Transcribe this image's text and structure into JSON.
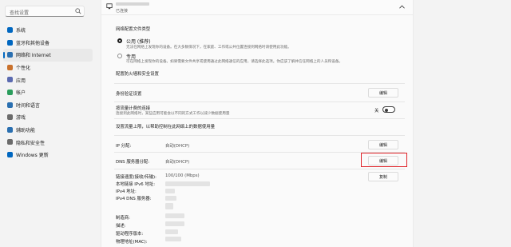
{
  "search": {
    "placeholder": "查找设置"
  },
  "sidebar": {
    "items": [
      {
        "label": "系统",
        "icon": "monitor-icon",
        "color": "#0067c0"
      },
      {
        "label": "蓝牙和其他设备",
        "icon": "bluetooth-icon",
        "color": "#0067c0"
      },
      {
        "label": "网络和 Internet",
        "icon": "network-icon",
        "color": "#2a6fb0",
        "active": true
      },
      {
        "label": "个性化",
        "icon": "brush-icon",
        "color": "#c9712c"
      },
      {
        "label": "应用",
        "icon": "apps-icon",
        "color": "#5b6ab0"
      },
      {
        "label": "帐户",
        "icon": "account-icon",
        "color": "#2a9d5c"
      },
      {
        "label": "时间和语言",
        "icon": "clock-globe-icon",
        "color": "#2a6fb0"
      },
      {
        "label": "游戏",
        "icon": "gamepad-icon",
        "color": "#6b6b6b"
      },
      {
        "label": "辅助功能",
        "icon": "accessibility-icon",
        "color": "#2a6fb0"
      },
      {
        "label": "隐私和安全性",
        "icon": "shield-icon",
        "color": "#6b6b6b"
      },
      {
        "label": "Windows 更新",
        "icon": "update-icon",
        "color": "#0067c0"
      }
    ]
  },
  "header": {
    "status": "已连接"
  },
  "profile": {
    "heading": "网络配置文件类型",
    "public_label": "公用 (推荐)",
    "public_desc": "无法在网络上发现你的设备。在大多数情况下，在家庭、工作或公共位置连接到网络时请使用此功能。",
    "private_label": "专用",
    "private_desc": "可在网络上发现你的设备。如果需要文件共享或使用通过此网络通信的应用，请选择此选项。你应该了解并信任网络上的人员和设备。",
    "firewall_link": "配置防火墙和安全设置"
  },
  "auth": {
    "label": "身份验证设置",
    "button": "编辑"
  },
  "metered": {
    "label": "按流量计费的连接",
    "desc": "连接到此网络时，某些应用可能会以不同的方式工作以减少数据使用量",
    "toggle_state": "关",
    "on": false
  },
  "data_limit": {
    "label": "设置流量上限，以帮助控制在此网络上的数据使用量"
  },
  "ip": {
    "label": "IP 分配:",
    "value": "自动(DHCP)",
    "button": "编辑"
  },
  "dns": {
    "label": "DNS 服务器分配:",
    "value": "自动(DHCP)",
    "button": "编辑"
  },
  "details": {
    "copy_button": "复制",
    "rows": [
      {
        "label": "链接速度(接收/传输):",
        "value": "100/100 (Mbps)"
      },
      {
        "label": "本地链接 IPv6 地址:",
        "value": ""
      },
      {
        "label": "IPv4 地址:",
        "value": ""
      },
      {
        "label": "IPv4 DNS 服务器:",
        "value": ""
      },
      {
        "label": "",
        "value": ""
      },
      {
        "label": "制造商:",
        "value": ""
      },
      {
        "label": "描述:",
        "value": ""
      },
      {
        "label": "驱动程序版本:",
        "value": ""
      },
      {
        "label": "物理地址(MAC):",
        "value": ""
      }
    ]
  }
}
